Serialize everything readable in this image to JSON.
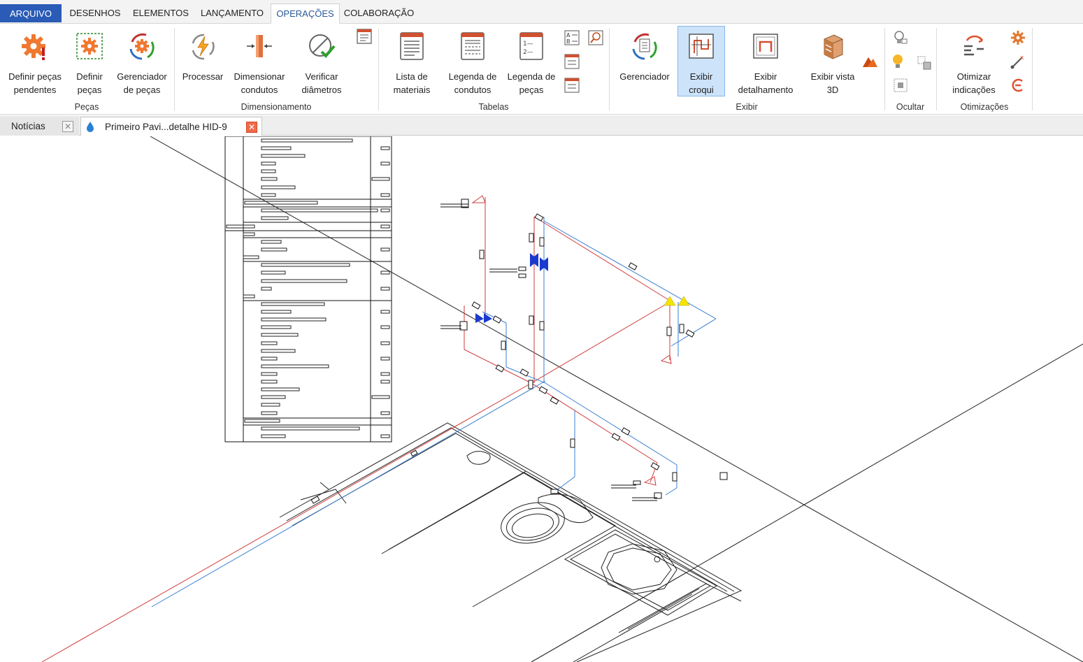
{
  "menu": {
    "file": "ARQUIVO",
    "tabs": [
      "DESENHOS",
      "ELEMENTOS",
      "LANÇAMENTO",
      "OPERAÇÕES",
      "COLABORAÇÃO"
    ],
    "active_tab": "OPERAÇÕES"
  },
  "ribbon": {
    "groups": {
      "pecas": "Peças",
      "dimensionamento": "Dimensionamento",
      "tabelas": "Tabelas",
      "exibir": "Exibir",
      "ocultar": "Ocultar",
      "otimizacoes": "Otimizações"
    },
    "buttons": {
      "definir_pecas_pendentes": "Definir peças\npendentes",
      "definir_pecas": "Definir\npeças",
      "gerenciador_de_pecas": "Gerenciador\nde peças",
      "processar": "Processar",
      "dimensionar_condutos": "Dimensionar\ncondutos",
      "verificar_diametros": "Verificar\ndiâmetros",
      "lista_de_materiais": "Lista de\nmateriais",
      "legenda_de_condutos": "Legenda de\ncondutos",
      "legenda_de_pecas": "Legenda de\npeças",
      "gerenciador": "Gerenciador",
      "exibir_croqui": "Exibir\ncroqui",
      "exibir_detalhamento": "Exibir\ndetalhamento",
      "exibir_vista_3d": "Exibir vista\n3D",
      "otimizar_indicacoes": "Otimizar\nindicações"
    },
    "selected_button": "Exibir croqui"
  },
  "doc_tabs": [
    {
      "label": "Notícias",
      "active": false
    },
    {
      "label": "Primeiro Pavi...detalhe HID-9",
      "active": true
    }
  ],
  "colors": {
    "accent": "#2a5bb6",
    "cold_water": "#3a7fd0",
    "hot_water": "#d03a3a",
    "highlight": "#cde3f9"
  },
  "icons": {
    "gear": "gear-icon",
    "droplet": "droplet-icon",
    "close": "close-icon"
  }
}
